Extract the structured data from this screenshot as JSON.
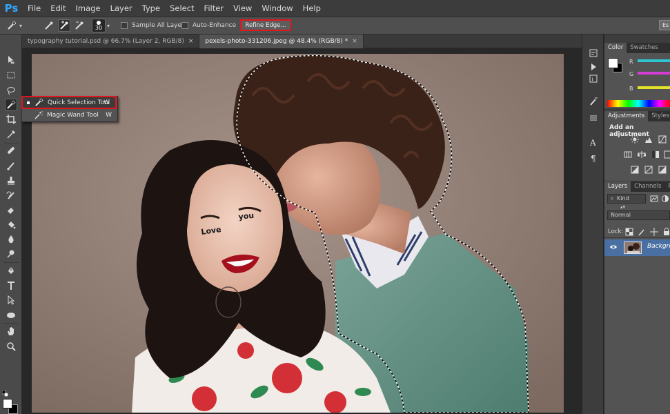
{
  "app": {
    "logo": "Ps"
  },
  "menu": [
    "File",
    "Edit",
    "Image",
    "Layer",
    "Type",
    "Select",
    "Filter",
    "View",
    "Window",
    "Help"
  ],
  "options": {
    "brush_size": "30",
    "sample_all_layers": "Sample All Layers",
    "auto_enhance": "Auto-Enhance",
    "refine_edge": "Refine Edge...",
    "essentials": "Es"
  },
  "tabs": [
    {
      "label": "typography tutorial.psd @ 66.7% (Layer 2, RGB/8)",
      "close": "×",
      "active": false
    },
    {
      "label": "pexels-photo-331206.jpeg @ 48.4% (RGB/8) *",
      "close": "×",
      "active": true
    }
  ],
  "flyout": {
    "items": [
      {
        "label": "Quick Selection Tool",
        "key": "W",
        "selected": true
      },
      {
        "label": "Magic Wand Tool",
        "key": "W",
        "selected": false
      }
    ]
  },
  "panels": {
    "color_tabs": [
      "Color",
      "Swatches"
    ],
    "sliders": [
      {
        "letter": "R",
        "color": "#2ec6d0"
      },
      {
        "letter": "G",
        "color": "#d63bd6"
      },
      {
        "letter": "B",
        "color": "#e2e22a"
      }
    ],
    "adjust_tabs": [
      "Adjustments",
      "Styles"
    ],
    "adjust_title": "Add an adjustment",
    "layers_tabs": [
      "Layers",
      "Channels",
      "P"
    ],
    "filter_kind": "Kind",
    "blend_mode": "Normal",
    "lock_label": "Lock:",
    "layer_name": "Background"
  },
  "colors": {
    "accent_red": "#e0151d",
    "selection": "#4a6fa3"
  }
}
